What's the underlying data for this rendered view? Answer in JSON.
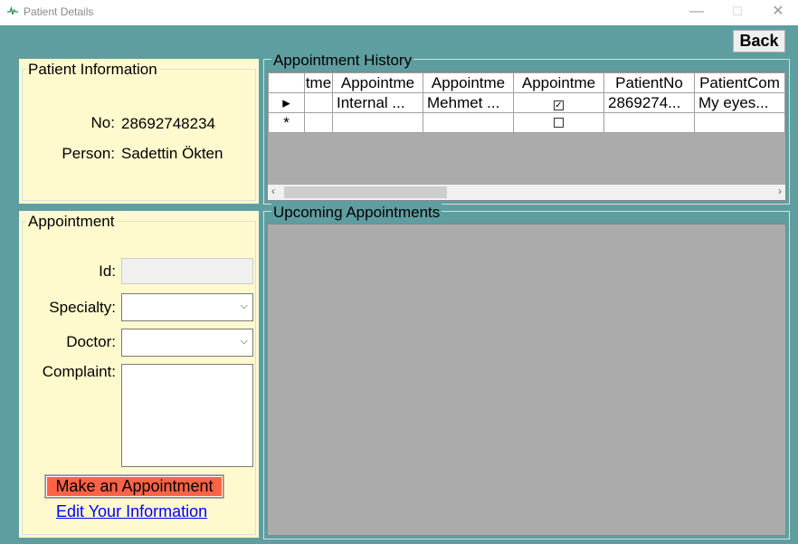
{
  "window": {
    "title": "Patient Details",
    "minimize_glyph": "—",
    "maximize_glyph": "☐",
    "close_glyph": "✕"
  },
  "toolbar": {
    "back_label": "Back"
  },
  "patient_info": {
    "title": "Patient Information",
    "no_label": "No:",
    "no_value": "28692748234",
    "person_label": "Person:",
    "person_value": "Sadettin Ökten"
  },
  "appointment": {
    "title": "Appointment",
    "id_label": "Id:",
    "specialty_label": "Specialty:",
    "doctor_label": "Doctor:",
    "complaint_label": "Complaint:",
    "make_button": "Make an Appointment",
    "edit_link": "Edit Your Information"
  },
  "history": {
    "title": "Appointment History",
    "columns": [
      "tme",
      "Appointme",
      "Appointme",
      "Appointme",
      "PatientNo",
      "PatientCom"
    ],
    "rows": [
      {
        "marker": "▸",
        "cells": [
          "",
          "Internal ...",
          "Mehmet ...",
          "",
          "2869274...",
          "My eyes..."
        ],
        "checked": true
      }
    ],
    "new_row_marker": "*"
  },
  "upcoming": {
    "title": "Upcoming Appointments"
  },
  "icons": {
    "app": "heartbeat-icon",
    "dropdown": "chevron-down-icon"
  },
  "colors": {
    "background": "#5f9ea0",
    "panel": "#fffacd",
    "button_accent": "#ff6347",
    "link": "#0000ff"
  }
}
